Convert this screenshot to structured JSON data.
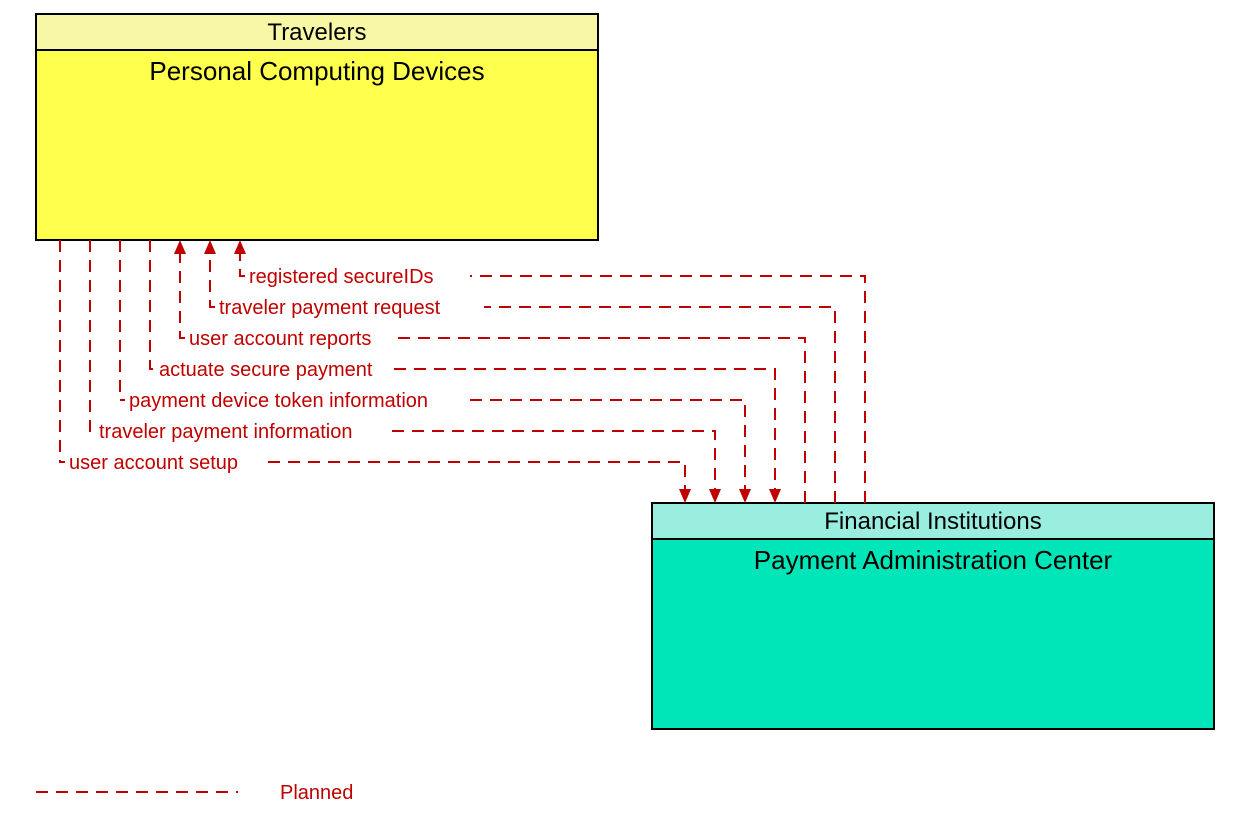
{
  "nodes": {
    "top": {
      "header": "Travelers",
      "body": "Personal Computing Devices",
      "colors": {
        "header_fill": "#f7f7a6",
        "body_fill": "#ffff4d"
      }
    },
    "bottom": {
      "header": "Financial Institutions",
      "body": "Payment Administration Center",
      "colors": {
        "header_fill": "#99eee0",
        "body_fill": "#00e6b8"
      }
    }
  },
  "flows": [
    {
      "label": "registered secureIDs",
      "from": "bottom",
      "to": "top"
    },
    {
      "label": "traveler payment request",
      "from": "bottom",
      "to": "top"
    },
    {
      "label": "user account reports",
      "from": "bottom",
      "to": "top"
    },
    {
      "label": "actuate secure payment",
      "from": "top",
      "to": "bottom"
    },
    {
      "label": "payment device token information",
      "from": "top",
      "to": "bottom"
    },
    {
      "label": "traveler payment information",
      "from": "top",
      "to": "bottom"
    },
    {
      "label": "user account setup",
      "from": "top",
      "to": "bottom"
    }
  ],
  "legend": {
    "label": "Planned"
  }
}
